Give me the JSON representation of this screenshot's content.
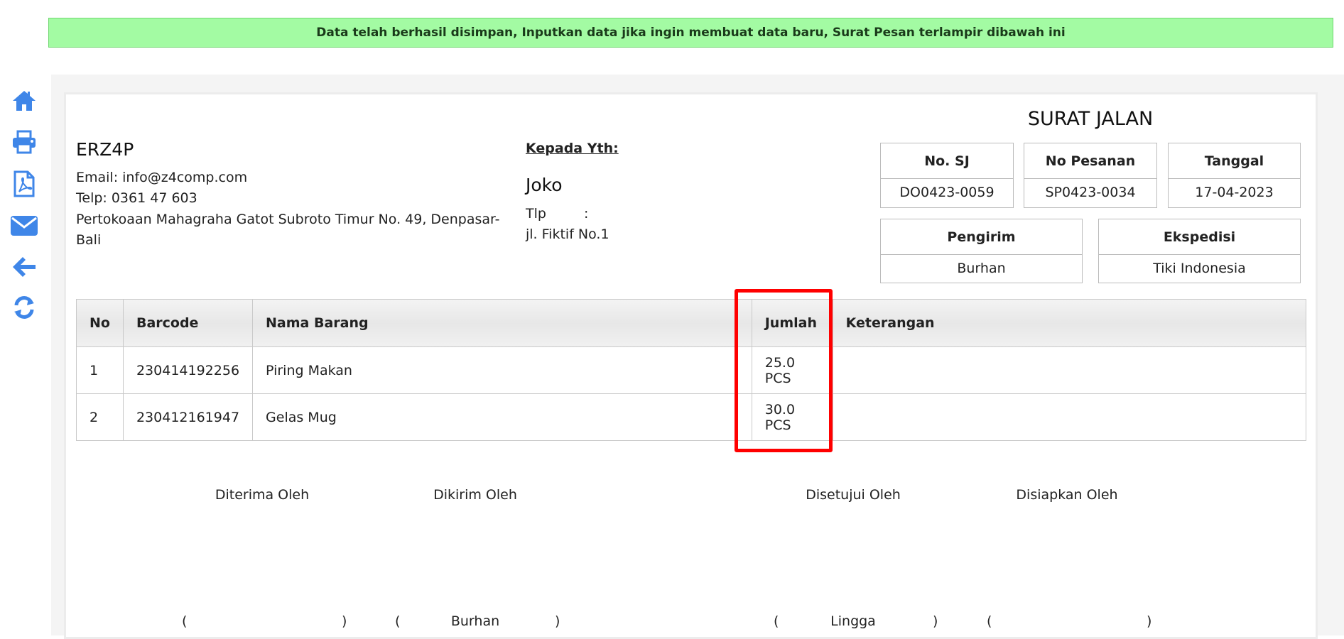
{
  "alert": {
    "message": "Data telah berhasil disimpan, Inputkan data jika ingin membuat data baru, Surat Pesan terlampir dibawah ini",
    "color": "#a3fba3"
  },
  "sidebar": {
    "icons": [
      "home-icon",
      "print-icon",
      "pdf-icon",
      "email-icon",
      "back-arrow-icon",
      "refresh-icon"
    ],
    "color": "#3f86e8"
  },
  "company": {
    "name": "ERZ4P",
    "email": "Email: info@z4comp.com",
    "phone": "Telp: 0361 47 603",
    "address_line1": "Pertokoaan Mahagraha Gatot Subroto Timur No. 49, Denpasar-",
    "address_line2": "Bali"
  },
  "recipient": {
    "label": "Kepada Yth:",
    "name": "Joko",
    "phone_label": "Tlp",
    "phone_sep": ":",
    "address": "jl. Fiktif No.1"
  },
  "document": {
    "title": "SURAT JALAN",
    "no_sj_label": "No. SJ",
    "no_sj": "DO0423-0059",
    "no_pesanan_label": "No Pesanan",
    "no_pesanan": "SP0423-0034",
    "tanggal_label": "Tanggal",
    "tanggal": "17-04-2023",
    "pengirim_label": "Pengirim",
    "pengirim": "Burhan",
    "ekspedisi_label": "Ekspedisi",
    "ekspedisi": "Tiki Indonesia"
  },
  "table": {
    "headers": {
      "no": "No",
      "barcode": "Barcode",
      "nama": "Nama Barang",
      "jumlah": "Jumlah",
      "keterangan": "Keterangan"
    },
    "rows": [
      {
        "no": "1",
        "barcode": "230414192256",
        "nama": "Piring Makan",
        "jumlah": "25.0 PCS",
        "keterangan": ""
      },
      {
        "no": "2",
        "barcode": "230412161947",
        "nama": "Gelas Mug",
        "jumlah": "30.0 PCS",
        "keterangan": ""
      }
    ]
  },
  "signatures": {
    "diterima_label": "Diterima Oleh",
    "dikirim_label": "Dikirim Oleh",
    "disetujui_label": "Disetujui Oleh",
    "disiapkan_label": "Disiapkan Oleh",
    "diterima_name": "",
    "dikirim_name": "Burhan",
    "disetujui_name": "Lingga",
    "disiapkan_name": "",
    "open_paren": "(",
    "close_paren": ")"
  },
  "highlight_color": "#ff0000"
}
